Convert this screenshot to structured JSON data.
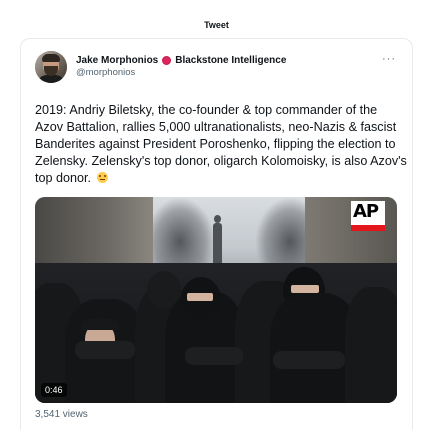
{
  "header": {
    "title": "Tweet"
  },
  "author": {
    "display_name": "Jake Morphonios",
    "affiliation": "Blackstone Intelligence",
    "handle": "@morphonios",
    "avatar_icon": "profile-photo",
    "badge_icon": "red-circle-icon"
  },
  "menu": {
    "more_icon": "···"
  },
  "tweet": {
    "text": "2019: Andriy Biletsky, the co-founder & top commander of the Azov Battalion, rallies 5,000 ultranationalists, neo-Nazis & fascist Banderites against President Poroshenko, flipping the election to Zelensky. Zelensky's top donor, oligarch Kolomoisky, is also Azov's top donor.",
    "emoji_icon": "thinking-face-icon"
  },
  "media": {
    "watermark": "AP",
    "duration": "0:46",
    "brand_color": "#e2161b"
  },
  "stats": {
    "views": "3,541 views"
  }
}
